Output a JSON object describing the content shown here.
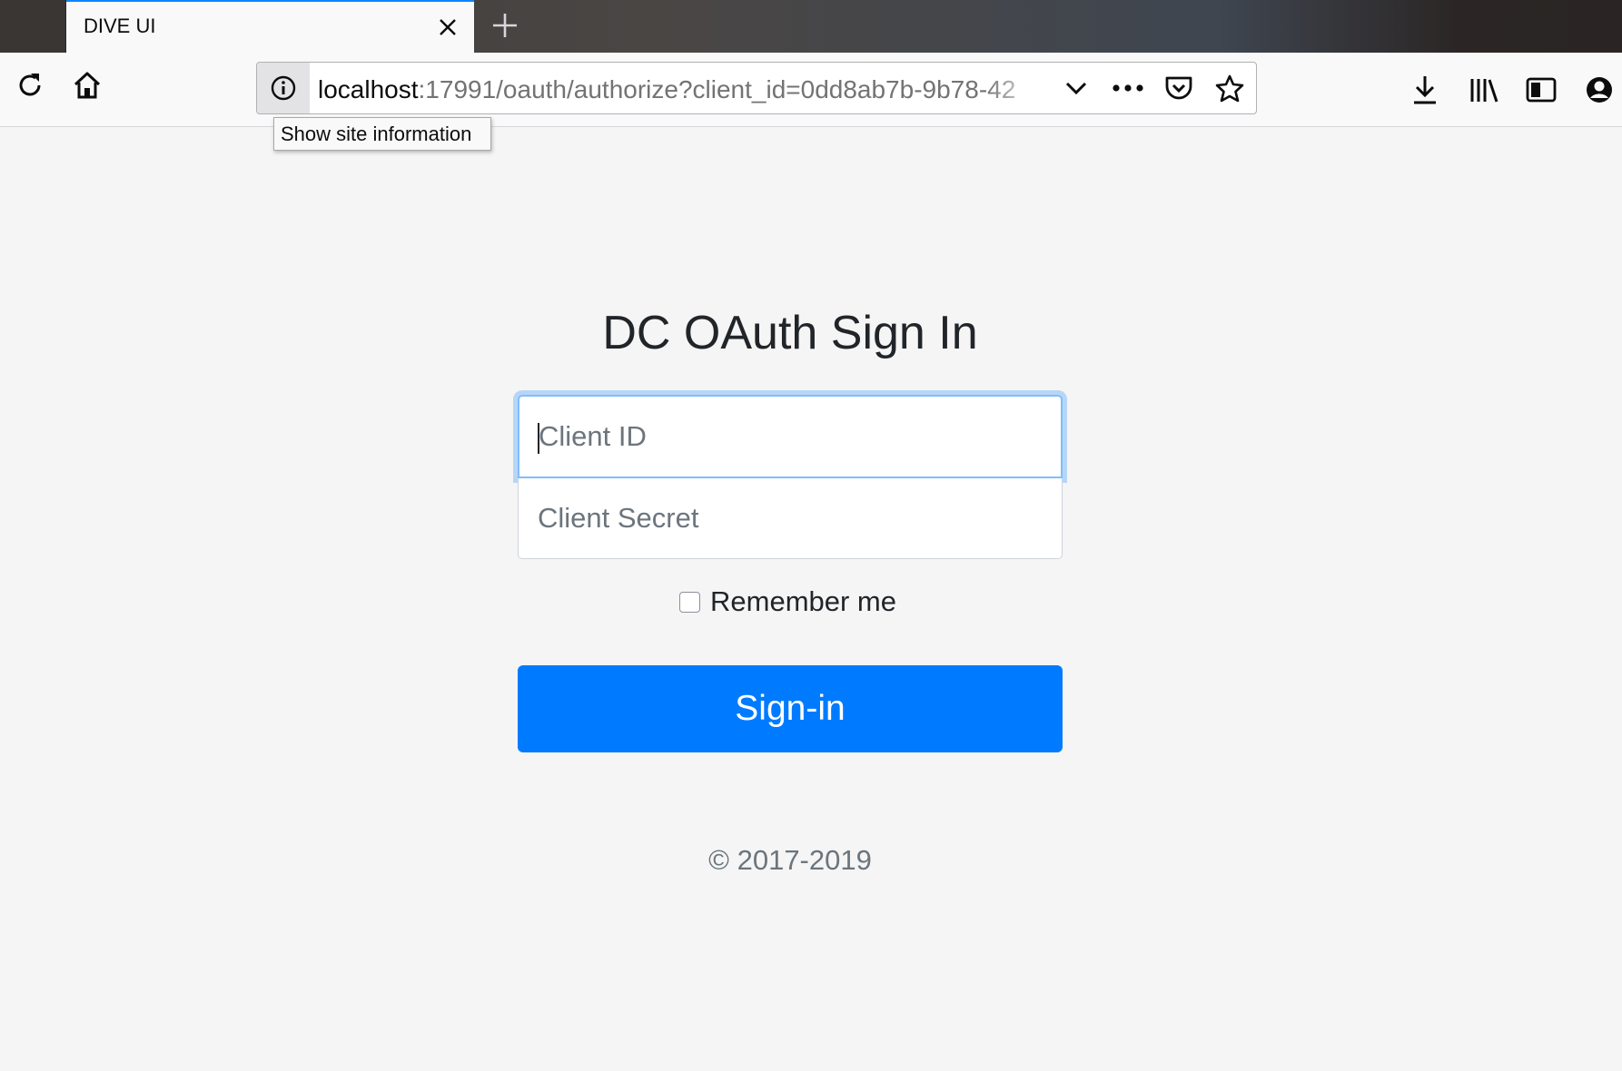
{
  "browser": {
    "tab": {
      "title": "DIVE UI"
    },
    "url": {
      "host": "localhost",
      "rest": ":17991/oauth/authorize?client_id=0dd8ab7b-9b78-42"
    },
    "tooltip": "Show site information",
    "icons": {
      "tab_close": "close-icon",
      "new_tab": "plus-icon",
      "reload": "reload-icon",
      "home": "home-icon",
      "site_info": "info-icon",
      "dropdown": "chevron-down-icon",
      "page_actions": "more-icon",
      "pocket": "pocket-icon",
      "bookmark": "star-icon",
      "downloads": "download-icon",
      "library": "library-icon",
      "sidebar": "sidebar-icon",
      "account": "account-icon"
    }
  },
  "form": {
    "title": "DC OAuth Sign In",
    "client_id_placeholder": "Client ID",
    "client_secret_placeholder": "Client Secret",
    "remember_label": "Remember me",
    "remember_checked": false,
    "signin_label": "Sign-in"
  },
  "footer": {
    "text": "© 2017-2019"
  },
  "colors": {
    "primary": "#007bff",
    "focus_ring": "#80bdff",
    "page_bg": "#f5f5f5"
  }
}
